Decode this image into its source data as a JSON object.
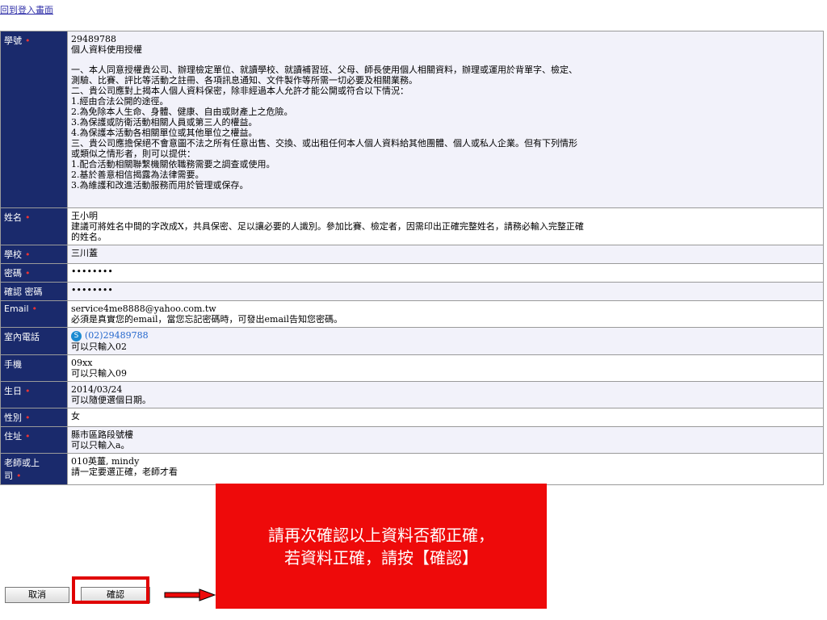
{
  "back_link": "回到登入畫面",
  "fields": {
    "student_id": {
      "label": "學號",
      "value": "29489788"
    },
    "consent": {
      "title": "個人資料使用授權",
      "lines": [
        "一、本人同意授權貴公司、辦理檢定單位、就讀學校、就讀補習班、父母、師長使用個人相關資料，辦理或運用於背單字、檢定、",
        "測驗、比賽、評比等活動之註冊、各項訊息通知、文件製作等所需一切必要及相關業務。",
        "二、貴公司應對上揭本人個人資料保密，除非經過本人允許才能公開或符合以下情況：",
        "1.經由合法公開的途徑。",
        "2.為免除本人生命、身體、健康、自由或財產上之危險。",
        "3.為保護或防衛活動相關人員或第三人的權益。",
        "4.為保護本活動各相關單位或其他單位之權益。",
        "三、貴公司應擔保絕不會意圖不法之所有任意出售、交換、或出租任何本人個人資料給其他團體、個人或私人企業。但有下列情形",
        "或類似之情形者，則可以提供：",
        "1.配合活動相關聯繫機關依職務需要之調查或使用。",
        "2.基於善意相信揭露為法律需要。",
        "3.為維護和改進活動服務而用於管理或保存。"
      ]
    },
    "name": {
      "label": "姓名",
      "value": "王小明",
      "note1": "建議可將姓名中間的字改成X，共具保密、足以讓必要的人識別。參加比賽、檢定者，因需印出正確完整姓名，請務必輸入完整正確",
      "note2": "的姓名。"
    },
    "school": {
      "label": "學校",
      "value": "三川蓋"
    },
    "password": {
      "label": "密碼",
      "value": "••••••••"
    },
    "password_confirm": {
      "label": "確認 密碼",
      "value": "••••••••"
    },
    "email": {
      "label": "Email",
      "value": "service4me8888@yahoo.com.tw",
      "note": "必須是真實您的email，當您忘記密碼時，可發出email告知您密碼。"
    },
    "home_phone": {
      "label": "室內電話",
      "icon": "S",
      "value": "(02)29489788",
      "note": "可以只輸入02"
    },
    "mobile": {
      "label": "手機",
      "value": "09xx",
      "note": "可以只輸入09"
    },
    "birthday": {
      "label": "生日",
      "value": "2014/03/24",
      "note": "可以隨便選個日期。"
    },
    "gender": {
      "label": "性別",
      "value": "女"
    },
    "address": {
      "label": "住址",
      "value": "縣市區路段號樓",
      "note": "可以只輸入a。"
    },
    "teacher": {
      "label1": "老師或上",
      "label2": "司",
      "value": "010英薑, mindy",
      "note": "請一定要選正確，老師才看"
    }
  },
  "buttons": {
    "cancel": "取消",
    "confirm": "確認"
  },
  "notice": {
    "line1": "請再次確認以上資料否都正確，",
    "line2": "若資料正確，請按【確認】"
  },
  "colors": {
    "label_bg": "#1a2a6c",
    "row_bg": "#f2f2fa",
    "notice_bg": "#ee0a0a",
    "highlight": "#e00000"
  }
}
